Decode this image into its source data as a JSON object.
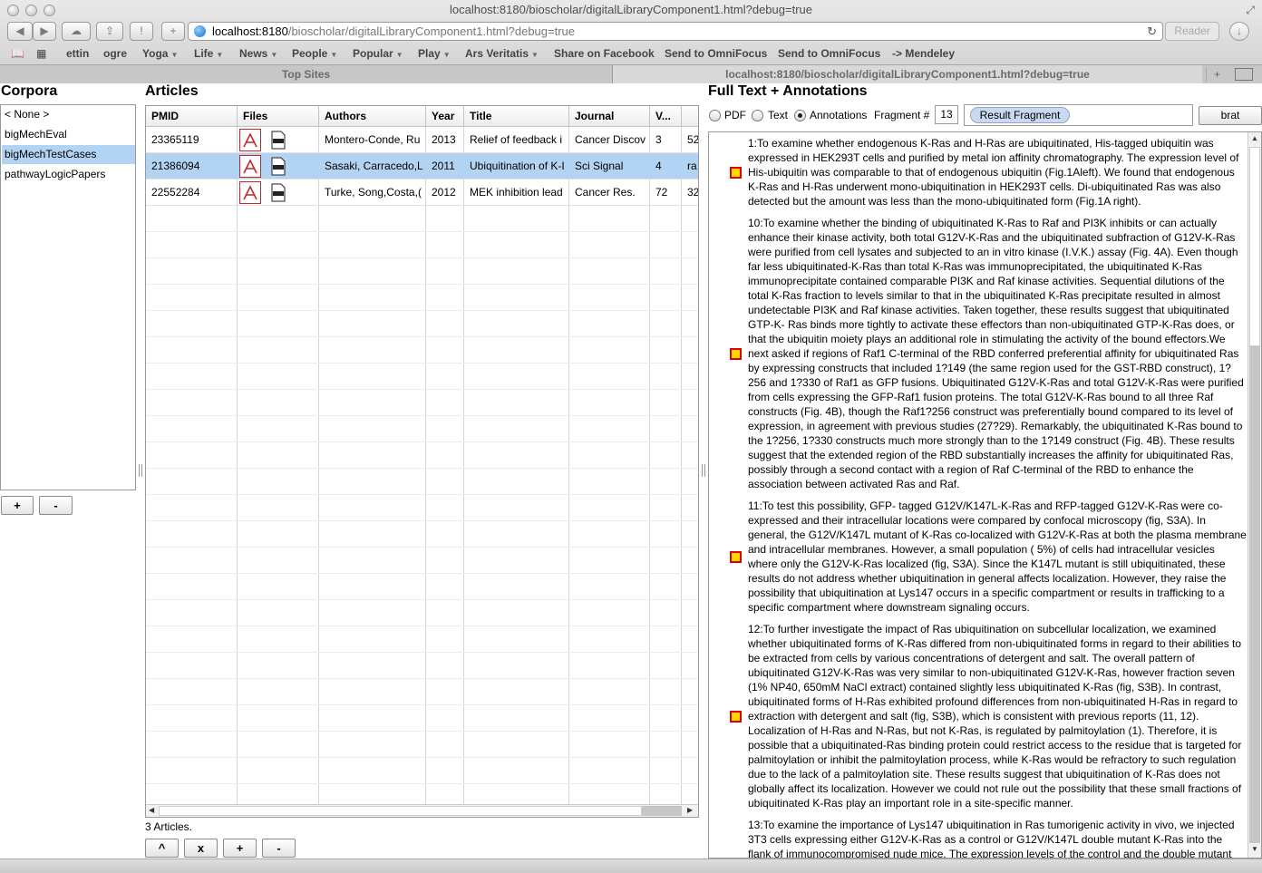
{
  "browser": {
    "window_title": "localhost:8180/bioscholar/digitalLibraryComponent1.html?debug=true",
    "address_host": "localhost:8180",
    "address_path": "/bioscholar/digitalLibraryComponent1.html?debug=true",
    "reader_label": "Reader",
    "nav": {
      "back": "◀",
      "forward": "▶",
      "icloud": "☁",
      "share": "⇪",
      "alert": "!",
      "add": "+"
    },
    "bookmarks": [
      {
        "label": "ettin",
        "menu": false
      },
      {
        "label": "ogre",
        "menu": false
      },
      {
        "label": "Yoga",
        "menu": true
      },
      {
        "label": "Life",
        "menu": true
      },
      {
        "label": "News",
        "menu": true
      },
      {
        "label": "People",
        "menu": true
      },
      {
        "label": "Popular",
        "menu": true
      },
      {
        "label": "Play",
        "menu": true
      },
      {
        "label": "Ars Veritatis",
        "menu": true
      },
      {
        "label": "Share on Facebook",
        "menu": false
      },
      {
        "label": "Send to OmniFocus",
        "menu": false
      },
      {
        "label": "Send to OmniFocus",
        "menu": false
      },
      {
        "label": "-> Mendeley",
        "menu": false
      }
    ],
    "tabs": [
      "Top Sites",
      "localhost:8180/bioscholar/digitalLibraryComponent1.html?debug=true"
    ]
  },
  "corpora": {
    "title": "Corpora",
    "items": [
      "< None >",
      "bigMechEval",
      "bigMechTestCases",
      "pathwayLogicPapers"
    ],
    "selected_index": 2,
    "add_label": "+",
    "remove_label": "-"
  },
  "articles": {
    "title": "Articles",
    "columns": [
      "PMID",
      "Files",
      "Authors",
      "Year",
      "Title",
      "Journal",
      "V...",
      ""
    ],
    "rows": [
      {
        "pmid": "23365119",
        "authors": "Montero-Conde, Ru",
        "year": "2013",
        "title": "Relief of feedback i",
        "journal": "Cancer Discov",
        "volume": "3",
        "extra": "52"
      },
      {
        "pmid": "21386094",
        "authors": "Sasaki, Carracedo,L",
        "year": "2011",
        "title": "Ubiquitination of K-I",
        "journal": "Sci Signal",
        "volume": "4",
        "extra": "ra"
      },
      {
        "pmid": "22552284",
        "authors": "Turke, Song,Costa,(",
        "year": "2012",
        "title": "MEK inhibition lead",
        "journal": "Cancer Res.",
        "volume": "72",
        "extra": "32"
      }
    ],
    "selected_index": 1,
    "count_label": "3 Articles.",
    "buttons": [
      "^",
      "x",
      "+",
      "-"
    ]
  },
  "fulltext": {
    "title": "Full Text + Annotations",
    "modes": [
      "PDF",
      "Text",
      "Annotations"
    ],
    "selected_mode": "Annotations",
    "fragment_label": "Fragment #",
    "fragment_value": "13",
    "fragment_pill": "Result Fragment",
    "brat_label": "brat",
    "paragraphs": [
      "1:To examine whether endogenous K-Ras and H-Ras are ubiquitinated,             His-tagged ubiquitin was expressed in HEK293T cells and purified by metal ion affinity chromatography. The expression level of His-ubiquitin was comparable to that of endogenous ubiquitin (Fig.1Aleft). We found that endogenous K-Ras and H-Ras underwent mono-ubiquitination in HEK293T cells. Di-ubiquitinated Ras was also detected but the amount was less than the mono-ubiquitinated form (Fig.1A right).",
      "10:To examine whether the binding of ubiquitinated K-Ras to Raf and PI3K inhibits or can actually enhance their kinase activity,    both total G12V-K-Ras and the ubiquitinated subfraction of G12V-K-Ras were purified from cell lysates and subjected to an in vitro kinase (I.V.K.) assay (Fig. 4A). Even though far less ubiquitinated-K-Ras than total K-Ras was immunoprecipitated, the ubiquitinated K-Ras immunoprecipitate contained comparable PI3K and Raf kinase activities. Sequential dilutions of the total K-Ras fraction to levels similar to that in the ubiquitinated K-Ras precipitate resulted in almost undetectable PI3K and Raf kinase activities. Taken together, these results suggest that ubiquitinated GTP-K- Ras binds more tightly to activate these effectors than non-ubiquitinated GTP-K-Ras does, or that the ubiquitin moiety plays an additional role in stimulating the activity of the bound effectors.We next asked if regions of Raf1 C-terminal of the RBD conferred preferential affinity for ubiquitinated Ras by expressing constructs that included 1?149 (the same region used for the GST-RBD construct), 1?256 and 1?330 of Raf1 as GFP fusions. Ubiquitinated G12V-K-Ras and total G12V-K-Ras were purified from cells expressing the GFP-Raf1 fusion proteins. The total G12V-K-Ras bound to all three Raf constructs (Fig. 4B), though the Raf1?256 construct was preferentially bound compared to its level of expression, in agreement with previous studies (27?29). Remarkably, the ubiquitinated K-Ras bound to the 1?256, 1?330 constructs much more strongly than to the 1?149 construct (Fig. 4B). These results suggest that the extended region of the RBD substantially increases the affinity for ubiquitinated Ras, possibly through a second contact with a region of Raf C-terminal of the RBD to enhance the association between activated Ras and Raf.",
      "11:To test this possibility,  GFP- tagged G12V/K147L-K-Ras and RFP-tagged G12V-K-Ras were co-expressed and their intracellular locations were compared by confocal microscopy (fig, S3A). In general, the G12V/K147L mutant of K-Ras co-localized with G12V-K-Ras at both the plasma membrane and intracellular membranes. However, a small population ( 5%) of cells had intracellular vesicles where only the G12V-K-Ras localized (fig, S3A). Since the K147L mutant is still ubiquitinated, these results do not address whether ubiquitination in general affects localization. However, they raise the possibility that ubiquitination at Lys147 occurs in a specific compartment or results in trafficking to a specific compartment where downstream signaling occurs.",
      "12:To further investigate the impact of Ras ubiquitination on subcellular localization,  we examined whether ubiquitinated forms of K-Ras differed from non-ubiquitinated forms in regard to their abilities to be extracted from cells by various concentrations of detergent and salt. The overall pattern of ubiquitinated G12V-K-Ras was very similar to non-ubiquitinated G12V-K-Ras, however fraction seven (1% NP40, 650mM NaCl extract) contained slightly less ubiquitinated K-Ras (fig, S3B). In contrast, ubiquitinated forms of H-Ras exhibited profound differences from non-ubiquitinated H-Ras in regard to extraction with detergent and salt (fig, S3B), which is consistent with previous reports (11, 12). Localization of H-Ras and N-Ras, but not K-Ras, is regulated by palmitoylation (1). Therefore, it is possible that a ubiquitinated-Ras binding protein could restrict access to the residue that is targeted for palmitoylation or inhibit the palmitoylation process, while K-Ras would be refractory to such regulation due to the lack of a palmitoylation site. These results suggest that ubiquitination of K-Ras does not globally affect its localization. However we could not rule out the possibility that these small fractions of ubiquitinated K-Ras play an important role in a site-specific manner.",
      "13:To examine the importance of Lys147 ubiquitination in Ras tumorigenic activity in vivo,    we injected 3T3 cells expressing either G12V-K-Ras as a control or G12V/K147L double mutant K-Ras into the flank of immunocompromised nude mice. The expression levels of the control and the double mutant"
    ]
  },
  "colors": {
    "selection": "#b3d3f3",
    "marker_fill": "#ffd800",
    "marker_border": "#e00000",
    "pdf_red": "#c0282c"
  }
}
